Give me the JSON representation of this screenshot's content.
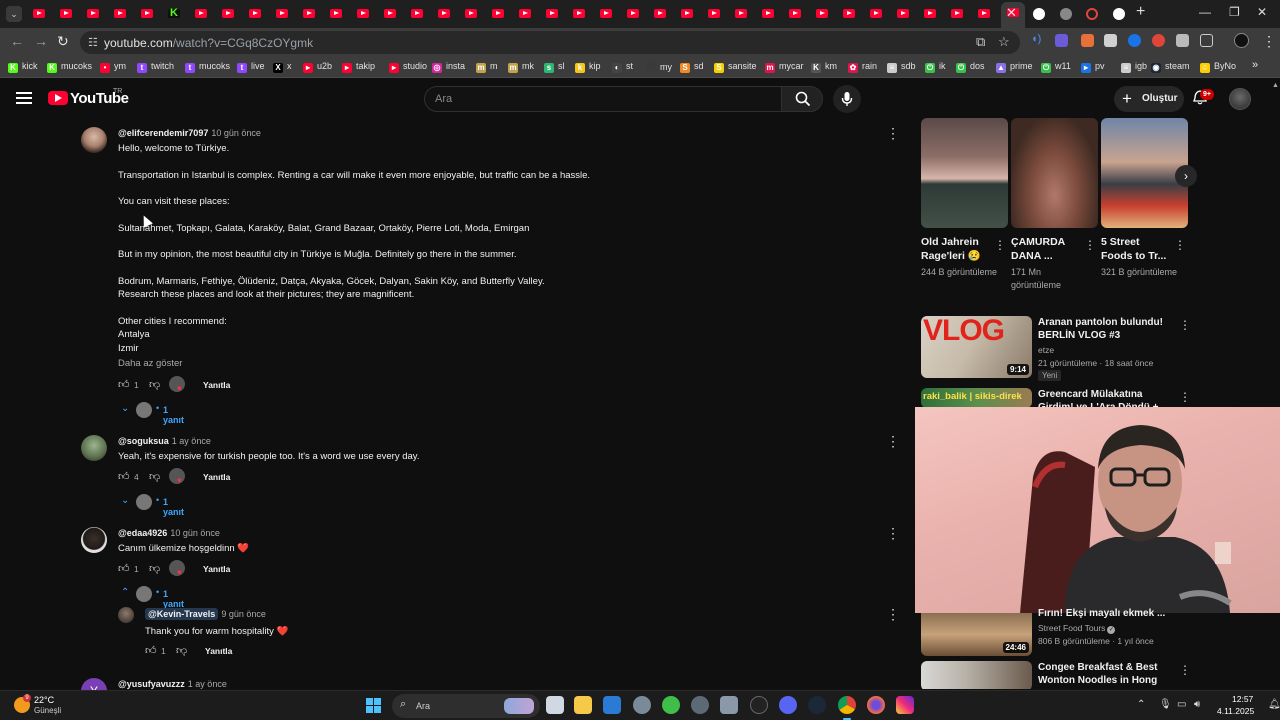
{
  "browser": {
    "tab_close": "✕",
    "new_tab": "+",
    "controls": {
      "minimize": "—",
      "restore": "❐",
      "close": "✕"
    },
    "url_host": "youtube.com",
    "url_rest": "/watch?v=CGq8CzOYgmk"
  },
  "bookmarks": [
    {
      "label": "kick",
      "color": "#53fc18",
      "glyph": "K"
    },
    {
      "label": "mucoks",
      "color": "#53fc18",
      "glyph": "K"
    },
    {
      "label": "ym",
      "color": "#ff0033",
      "glyph": "•"
    },
    {
      "label": "twitch",
      "color": "#9146ff",
      "glyph": "t"
    },
    {
      "label": "mucoks",
      "color": "#9146ff",
      "glyph": "t"
    },
    {
      "label": "live",
      "color": "#9146ff",
      "glyph": "t"
    },
    {
      "label": "x",
      "color": "#000000",
      "glyph": "X"
    },
    {
      "label": "u2b",
      "color": "#ff0033",
      "glyph": "▸"
    },
    {
      "label": "takip",
      "color": "#ff0033",
      "glyph": "▸"
    },
    {
      "label": "studio",
      "color": "#ff0033",
      "glyph": "▸"
    },
    {
      "label": "insta",
      "color": "#d6249f",
      "glyph": "◎"
    },
    {
      "label": "m",
      "color": "#c2a24a",
      "glyph": "m"
    },
    {
      "label": "mk",
      "color": "#c2a24a",
      "glyph": "m"
    },
    {
      "label": "sl",
      "color": "#2bb673",
      "glyph": "s"
    },
    {
      "label": "kip",
      "color": "#f5c518",
      "glyph": "k"
    },
    {
      "label": "st",
      "color": "#444444",
      "glyph": "◐"
    },
    {
      "label": "my",
      "color": "#3a3a3a",
      "glyph": ""
    },
    {
      "label": "sd",
      "color": "#f08a24",
      "glyph": "S"
    },
    {
      "label": "sansite",
      "color": "#f5d000",
      "glyph": "S"
    },
    {
      "label": "mycar",
      "color": "#e0144c",
      "glyph": "m"
    },
    {
      "label": "km",
      "color": "#555555",
      "glyph": "K"
    },
    {
      "label": "rain",
      "color": "#e0144c",
      "glyph": "✿"
    },
    {
      "label": "sdb",
      "color": "#cccccc",
      "glyph": "≡"
    },
    {
      "label": "ik",
      "color": "#36c24a",
      "glyph": "⏻"
    },
    {
      "label": "dos",
      "color": "#36c24a",
      "glyph": "⏻"
    },
    {
      "label": "prime",
      "color": "#8a6fe8",
      "glyph": "▲"
    },
    {
      "label": "w11",
      "color": "#36c24a",
      "glyph": "⏻"
    },
    {
      "label": "pv",
      "color": "#1a73e8",
      "glyph": "▸"
    },
    {
      "label": "igb",
      "color": "#cccccc",
      "glyph": "≡"
    },
    {
      "label": "steam",
      "color": "#1b2838",
      "glyph": "◉"
    },
    {
      "label": "ByNo",
      "color": "#ffcc00",
      "glyph": "☺"
    }
  ],
  "bookmarks_overflow": "»",
  "masthead": {
    "logo_text": "YouTube",
    "country_code": "TR",
    "search_placeholder": "Ara",
    "create_label": "Oluştur",
    "notification_count": "9+"
  },
  "comments": [
    {
      "author": "@elifcerendemir7097",
      "time": "10 gün önce",
      "lines": [
        "Hello, welcome to Türkiye.",
        "",
        "Transportation in Istanbul is complex. Renting a car will make it even more enjoyable, but traffic can be a hassle.",
        "",
        "You can visit these places:",
        "",
        "Sultanahmet, Topkapı, Galata, Karaköy, Balat, Grand Bazaar, Ortaköy, Pierre Loti, Moda, Emirgan",
        "",
        "But in my opinion, the most beautiful city in Türkiye is Muğla. Definitely go there in the summer.",
        "",
        "Bodrum, Marmaris, Fethiye, Ölüdeniz, Datça, Akyaka, Göcek, Dalyan, Sakin Köy, and Butterfly Valley.",
        "Research these places and look at their pictures; they are magnificent.",
        "",
        "Other cities I recommend:",
        "Antalya",
        "Izmir"
      ],
      "show_less": "Daha az göster",
      "likes": "1",
      "reply_label": "Yanıtla",
      "replies": "1 yanıt"
    },
    {
      "author": "@soguksua",
      "time": "1 ay önce",
      "lines": [
        "Yeah, it's expensive for turkish people too. It's a word we use every day."
      ],
      "likes": "4",
      "reply_label": "Yanıtla",
      "replies": "1 yanıt"
    },
    {
      "author": "@edaa4926",
      "time": "10 gün önce",
      "lines": [
        "Canım ülkemize hoşgeldinn ❤️"
      ],
      "likes": "1",
      "reply_label": "Yanıtla",
      "replies": "1 yanıt",
      "reply": {
        "author": "@Kevin-Travels",
        "time": "9 gün önce",
        "text": "Thank you for warm hospitality ❤️",
        "likes": "1",
        "reply_label": "Yanıtla"
      }
    },
    {
      "author": "@yusufyavuzzz",
      "time": "1 ay önce",
      "avatar_letter": "Y"
    }
  ],
  "shorts": [
    {
      "title": "Old Jahrein Rage'leri 😢",
      "views": "244 B görüntüleme"
    },
    {
      "title": "ÇAMURDA DANA ...",
      "views": "171 Mn görüntüleme"
    },
    {
      "title": "5 Street Foods to Tr...",
      "views": "321 B görüntüleme"
    }
  ],
  "recommendations": [
    {
      "title": "Aranan pantolon bulundu! BERLİN VLOG #3",
      "channel": "etze",
      "meta": "21 görüntüleme · 18 saat önce",
      "badge": "Yeni",
      "duration": "9:14",
      "thumb_text": "VLOG"
    },
    {
      "title": "Greencard Mülakatına Girdim! ve L'Ara Döndü + iPhone 17 Pr...",
      "thumb_text": "raki_balik | sikis-direk"
    },
    {
      "title": "Fırın! Ekşi mayalı ekmek ...",
      "channel": "Street Food Tours",
      "meta": "806 B görüntüleme · 1 yıl önce",
      "duration": "24:46"
    },
    {
      "title": "Congee Breakfast & Best Wonton Noodles in Hong Kong..."
    }
  ],
  "taskbar": {
    "temperature": "22°C",
    "weather": "Güneşli",
    "weather_alert": "9",
    "search_label": "Ara",
    "time": "12:57",
    "date": "4.11.2025"
  }
}
